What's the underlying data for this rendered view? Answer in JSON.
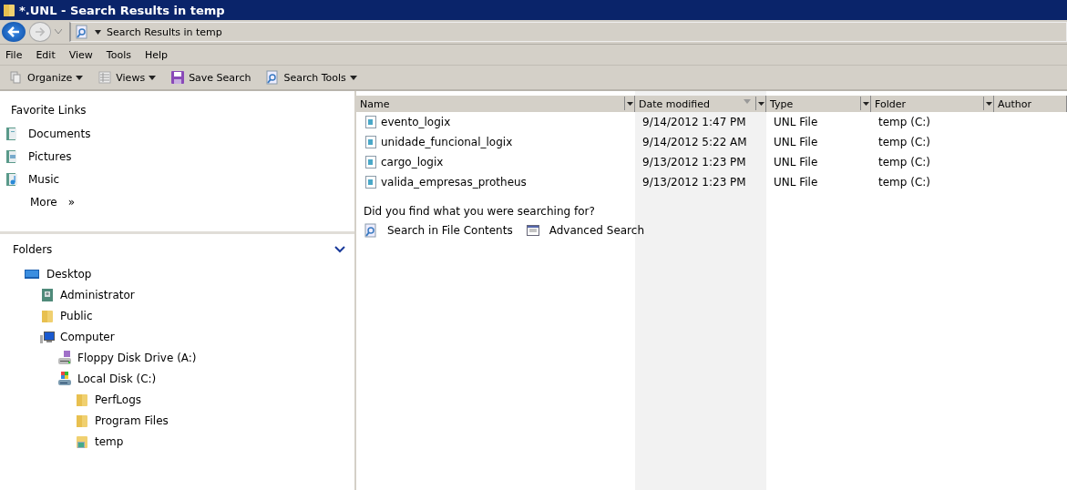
{
  "window": {
    "title": "*.UNL - Search Results in temp"
  },
  "address_bar": {
    "path": "Search Results in temp"
  },
  "menu": [
    "File",
    "Edit",
    "View",
    "Tools",
    "Help"
  ],
  "toolbar": [
    {
      "label": "Organize",
      "kind": "organize",
      "dropdown": true
    },
    {
      "label": "Views",
      "kind": "views",
      "dropdown": true
    },
    {
      "label": "Save Search",
      "kind": "save",
      "dropdown": false
    },
    {
      "label": "Search Tools",
      "kind": "search",
      "dropdown": true
    }
  ],
  "favorite_links": {
    "title": "Favorite Links",
    "items": [
      {
        "label": "Documents",
        "kind": "documents"
      },
      {
        "label": "Pictures",
        "kind": "pictures"
      },
      {
        "label": "Music",
        "kind": "music"
      }
    ],
    "more": "More",
    "more_icon": "»"
  },
  "folders": {
    "title": "Folders",
    "expanded": true,
    "items": [
      {
        "label": "Desktop",
        "kind": "desktop",
        "children": [
          {
            "label": "Administrator",
            "kind": "user"
          },
          {
            "label": "Public",
            "kind": "folder"
          },
          {
            "label": "Computer",
            "kind": "computer",
            "children": [
              {
                "label": "Floppy Disk Drive (A:)",
                "kind": "floppy"
              },
              {
                "label": "Local Disk (C:)",
                "kind": "disk",
                "children": [
                  {
                    "label": "PerfLogs",
                    "kind": "folder"
                  },
                  {
                    "label": "Program Files",
                    "kind": "folder"
                  },
                  {
                    "label": "temp",
                    "kind": "search-folder"
                  }
                ]
              }
            ]
          }
        ]
      }
    ]
  },
  "table": {
    "columns": [
      {
        "label": "Name",
        "sorted": false
      },
      {
        "label": "Date modified",
        "sorted": true
      },
      {
        "label": "Type",
        "sorted": false
      },
      {
        "label": "Folder",
        "sorted": false
      },
      {
        "label": "Author",
        "sorted": false
      }
    ],
    "rows": [
      {
        "name": "evento_logix",
        "date": "9/14/2012 1:47 PM",
        "type": "UNL File",
        "folder": "temp (C:)"
      },
      {
        "name": "unidade_funcional_logix",
        "date": "9/14/2012 5:22 AM",
        "type": "UNL File",
        "folder": "temp (C:)"
      },
      {
        "name": "cargo_logix",
        "date": "9/13/2012 1:23 PM",
        "type": "UNL File",
        "folder": "temp (C:)"
      },
      {
        "name": "valida_empresas_protheus",
        "date": "9/13/2012 1:23 PM",
        "type": "UNL File",
        "folder": "temp (C:)"
      }
    ]
  },
  "search_prompt": {
    "question": "Did you find what you were searching for?",
    "links": [
      {
        "label": "Search in File Contents",
        "kind": "search"
      },
      {
        "label": "Advanced Search",
        "kind": "advanced"
      }
    ]
  }
}
